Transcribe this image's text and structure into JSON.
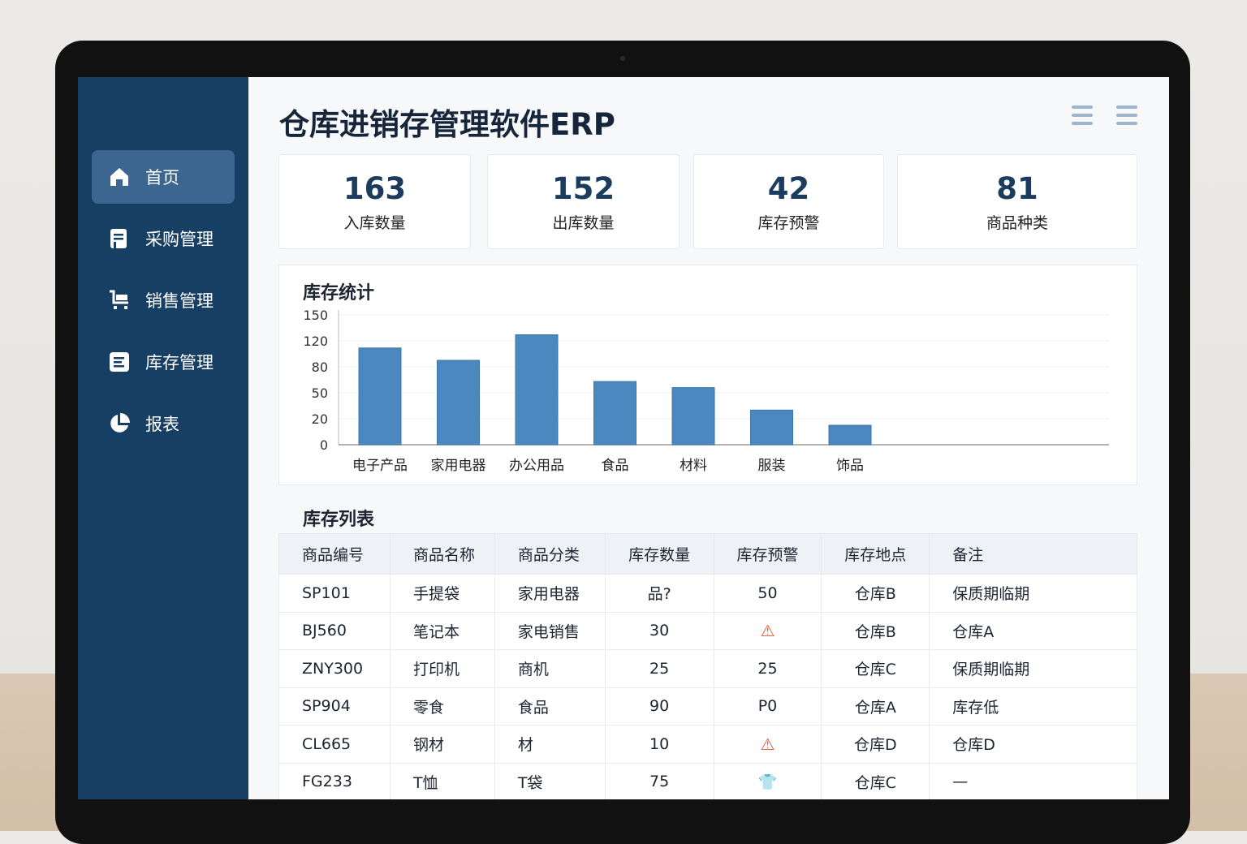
{
  "app": {
    "title": "仓库进销存管理软件ERP"
  },
  "sidebar": {
    "items": [
      {
        "label": "首页",
        "icon": "home-icon"
      },
      {
        "label": "采购管理",
        "icon": "purchase-icon"
      },
      {
        "label": "销售管理",
        "icon": "cart-icon"
      },
      {
        "label": "库存管理",
        "icon": "inventory-icon"
      },
      {
        "label": "报表",
        "icon": "pie-chart-icon"
      }
    ]
  },
  "stats": [
    {
      "value": "163",
      "label": "入库数量"
    },
    {
      "value": "152",
      "label": "出库数量"
    },
    {
      "value": "42",
      "label": "库存预警"
    },
    {
      "value": "81",
      "label": "商品种类"
    }
  ],
  "chart_data": {
    "type": "bar",
    "title": "库存统计",
    "categories": [
      "电子产品",
      "家用电器",
      "办公用品",
      "食品",
      "材料",
      "服装",
      "饰品"
    ],
    "values": [
      109,
      90,
      127,
      63,
      56,
      30,
      15
    ],
    "yticks": [
      0,
      20,
      50,
      80,
      120,
      150
    ],
    "ylim": [
      0,
      150
    ],
    "grid": true,
    "bar_color": "#4a88bf"
  },
  "table": {
    "title": "库存列表",
    "headers": [
      "商品编号",
      "商品名称",
      "商品分类",
      "库存数量",
      "库存预警",
      "库存地点",
      "备注"
    ],
    "rows": [
      [
        "SP101",
        "手提袋",
        "家用电器",
        "品?",
        "50",
        "仓库B",
        "保质期临期"
      ],
      [
        "BJ560",
        "笔记本",
        "家电销售",
        "30",
        "⚠",
        "仓库B",
        "仓库A"
      ],
      [
        "ZNY300",
        "打印机",
        "商机",
        "25",
        "25",
        "仓库C",
        "保质期临期"
      ],
      [
        "SP904",
        "零食",
        "食品",
        "90",
        "P0",
        "仓库A",
        "库存低"
      ],
      [
        "CL665",
        "钢材",
        "材",
        "10",
        "⚠",
        "仓库D",
        "仓库D"
      ],
      [
        "FG233",
        "T恤",
        "T袋",
        "75",
        "👕",
        "仓库C",
        "—"
      ]
    ]
  },
  "colors": {
    "sidebar": "#173f63",
    "accent": "#4a88bf",
    "warning": "#e4572e"
  }
}
